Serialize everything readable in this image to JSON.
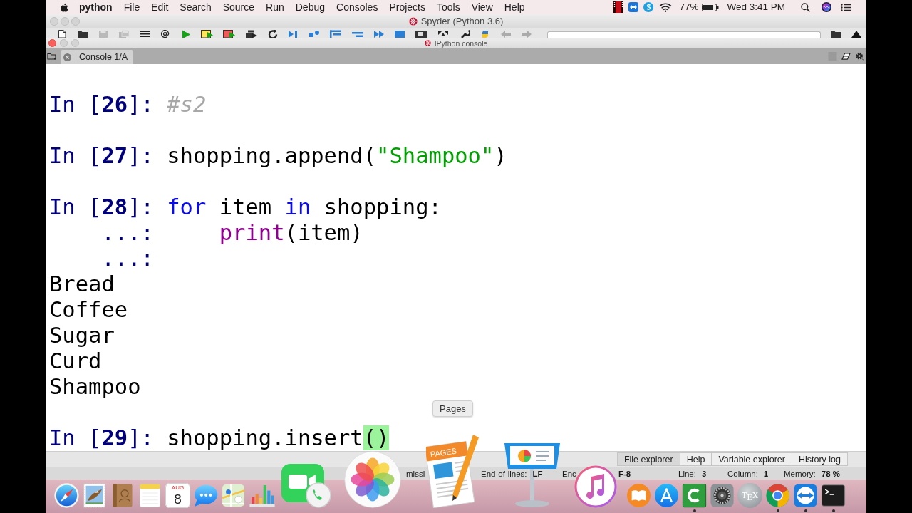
{
  "menu_bar": {
    "app": "python",
    "menus": [
      "File",
      "Edit",
      "Search",
      "Source",
      "Run",
      "Debug",
      "Consoles",
      "Projects",
      "Tools",
      "View",
      "Help"
    ],
    "battery": "77%",
    "clock": "Wed 3:41 PM"
  },
  "window": {
    "title": "Spyder (Python 3.6)"
  },
  "toolbar": [
    {
      "kind": "new-file",
      "disabled": false
    },
    {
      "kind": "open",
      "disabled": false
    },
    {
      "kind": "save",
      "disabled": true
    },
    {
      "kind": "save-all",
      "disabled": true
    },
    {
      "kind": "list",
      "disabled": false
    },
    {
      "kind": "at",
      "disabled": false
    },
    {
      "kind": "run",
      "disabled": false
    },
    {
      "kind": "run-cell",
      "disabled": false
    },
    {
      "kind": "run-cell-advance",
      "disabled": false
    },
    {
      "kind": "run-selection",
      "disabled": false
    },
    {
      "kind": "rerun",
      "disabled": false
    },
    {
      "kind": "debug",
      "disabled": false
    },
    {
      "kind": "step",
      "disabled": false
    },
    {
      "kind": "step-into",
      "disabled": false
    },
    {
      "kind": "step-return",
      "disabled": false
    },
    {
      "kind": "continue",
      "disabled": false
    },
    {
      "kind": "stop",
      "disabled": false
    },
    {
      "kind": "maximize",
      "disabled": false
    },
    {
      "kind": "fullscreen",
      "disabled": false
    },
    {
      "kind": "preferences",
      "disabled": false
    },
    {
      "kind": "python-path",
      "disabled": false
    },
    {
      "kind": "back",
      "disabled": true
    },
    {
      "kind": "forward",
      "disabled": true
    },
    {
      "kind": "path",
      "disabled": false
    },
    {
      "kind": "browse",
      "disabled": false
    },
    {
      "kind": "parent",
      "disabled": false
    }
  ],
  "console_pane": {
    "title": "IPython console",
    "tabs": [
      {
        "label": "Console 1/A",
        "selected": true
      }
    ],
    "lines": [
      {
        "kind": "input",
        "prompt": "In [**26**]:",
        "code": [
          {
            "kind": "comment",
            "text": "#s2"
          }
        ]
      },
      {
        "kind": "input",
        "prompt": "In [**27**]:",
        "code": [
          {
            "kind": "plain",
            "text": "shopping.append("
          },
          {
            "kind": "string",
            "text": "\"Shampoo\""
          },
          {
            "kind": "plain",
            "text": ")"
          }
        ]
      },
      {
        "kind": "input",
        "prompt": "In [**28**]:",
        "code": [
          {
            "kind": "keyword",
            "text": "for"
          },
          {
            "kind": "plain",
            "text": " item "
          },
          {
            "kind": "keyword",
            "text": "in"
          },
          {
            "kind": "plain",
            "text": " shopping:"
          }
        ],
        "children": [
          {
            "kind": "continuation",
            "prompt": "...:",
            "code": [
              {
                "kind": "builtin",
                "text": "print"
              },
              {
                "kind": "plain",
                "text": "(item)"
              }
            ]
          }
        ]
      },
      {
        "kind": "continuation",
        "prompt": "...:"
      },
      {
        "kind": "output",
        "text": "Bread"
      },
      {
        "kind": "output",
        "text": "Coffee"
      },
      {
        "kind": "output",
        "text": "Sugar"
      },
      {
        "kind": "output",
        "text": "Curd"
      },
      {
        "kind": "output",
        "text": "Shampoo"
      },
      {
        "kind": "input",
        "prompt": "In [**29**]:",
        "code": [
          {
            "kind": "plain",
            "text": "shopping.insert"
          },
          {
            "kind": "match",
            "text": "()"
          }
        ]
      }
    ]
  },
  "pane_tabs": [
    {
      "label": "File explorer",
      "selected": true
    },
    {
      "label": "Help",
      "selected": false
    },
    {
      "label": "Variable explorer",
      "selected": false
    },
    {
      "label": "History log",
      "selected": false
    }
  ],
  "status_bar": [
    {
      "label": "missi"
    },
    {
      "label": "End-of-lines:",
      "value": "LF"
    },
    {
      "label": "Enc"
    },
    {
      "value": "F-8"
    },
    {
      "label": "Line:",
      "value": "3"
    },
    {
      "label": "Column:",
      "value": "1"
    },
    {
      "label": "Memory:",
      "value": "78 %"
    }
  ],
  "dock": {
    "tooltip": "Pages",
    "items": [
      {
        "kind": "safari",
        "running": false
      },
      {
        "kind": "mail",
        "running": false
      },
      {
        "kind": "contacts",
        "running": false
      },
      {
        "kind": "notes",
        "running": false
      },
      {
        "kind": "calendar",
        "month": "AUG",
        "day": "8",
        "running": false
      },
      {
        "kind": "messages",
        "running": false
      },
      {
        "kind": "maps",
        "running": false
      },
      {
        "kind": "numbers",
        "running": false
      },
      {
        "kind": "facetime",
        "running": false
      },
      {
        "kind": "photos",
        "running": false
      },
      {
        "kind": "pages",
        "label": "PAGES",
        "running": false
      },
      {
        "kind": "keynote",
        "running": false
      },
      {
        "kind": "itunes",
        "running": false
      },
      {
        "kind": "ibooks",
        "running": false
      },
      {
        "kind": "appstore",
        "running": false
      },
      {
        "kind": "camtasia",
        "running": true
      },
      {
        "kind": "sysprefs",
        "running": false
      },
      {
        "kind": "tex",
        "label": "T$_{E}$X",
        "running": false
      },
      {
        "kind": "chrome",
        "running": true
      },
      {
        "kind": "teamviewer",
        "running": true
      },
      {
        "kind": "terminal",
        "running": true
      }
    ]
  }
}
